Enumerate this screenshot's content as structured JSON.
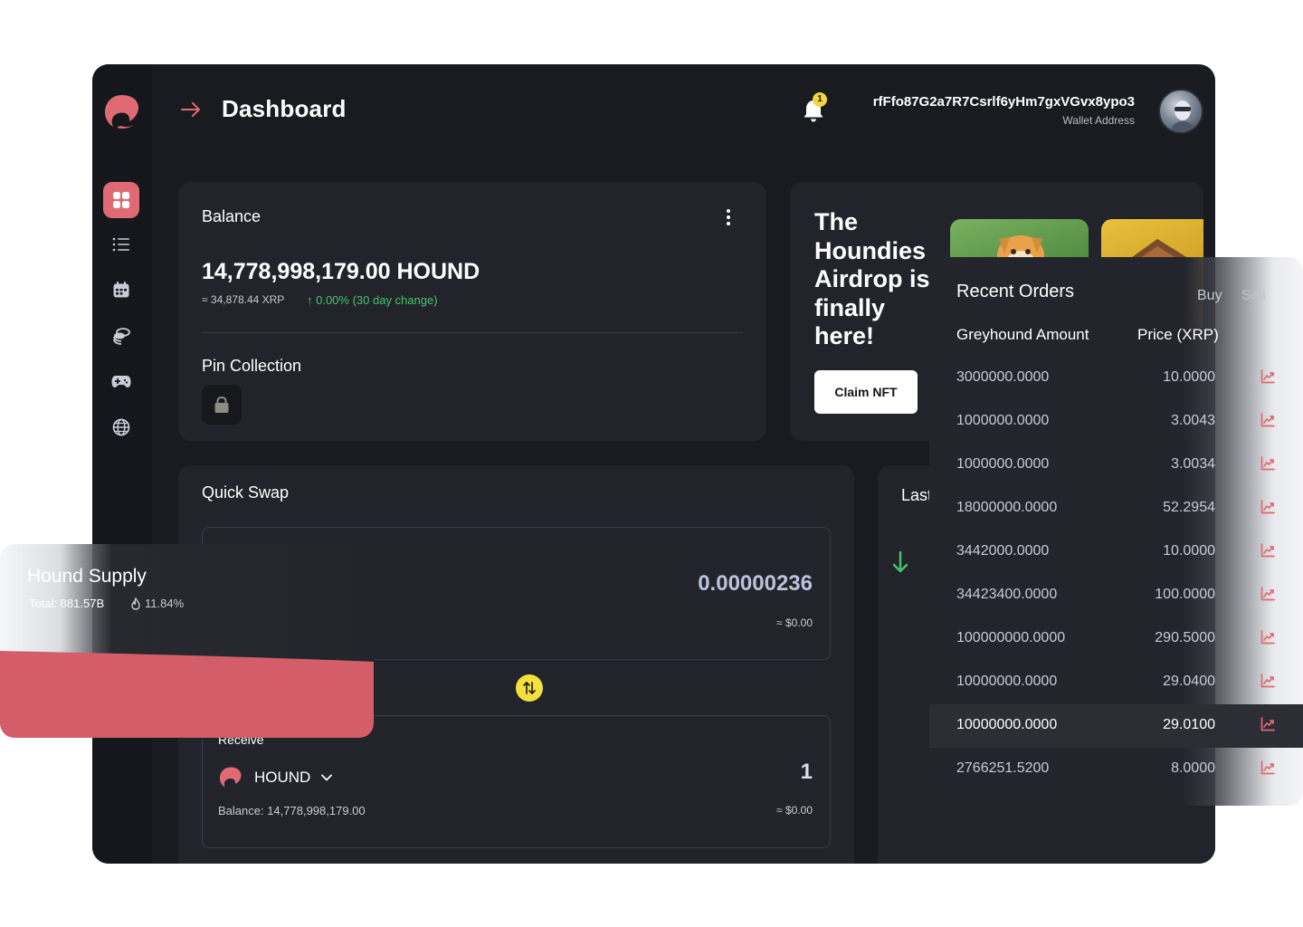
{
  "header": {
    "title": "Dashboard",
    "notification_count": "1",
    "wallet_address": "rfFfo87G2a7R7Csrlf6yHm7gxVGvx8ypo3",
    "wallet_label": "Wallet Address"
  },
  "sidebar": {
    "items": [
      {
        "icon": "grid-icon",
        "active": true
      },
      {
        "icon": "list-icon",
        "active": false
      },
      {
        "icon": "calendar-icon",
        "active": false
      },
      {
        "icon": "coins-icon",
        "active": false
      },
      {
        "icon": "gamepad-icon",
        "active": false
      },
      {
        "icon": "globe-icon",
        "active": false
      }
    ]
  },
  "balance": {
    "title": "Balance",
    "amount": "14,778,998,179.00 HOUND",
    "xrp": "≈ 34,878.44 XRP",
    "change": "↑ 0.00% (30 day change)",
    "pin_title": "Pin Collection"
  },
  "airdrop": {
    "title": "The Houndies Airdrop is finally here!",
    "button_label": "Claim NFT"
  },
  "swap": {
    "title": "Quick Swap",
    "top_value": "0.00000236",
    "top_usd": "≈ $0.00",
    "receive_label": "Receive",
    "token": "HOUND",
    "receive_value": "1",
    "receive_balance": "Balance: 14,778,998,179.00",
    "receive_usd": "≈ $0.00"
  },
  "last": {
    "title": "Last"
  },
  "supply": {
    "title": "Hound Supply",
    "total": "Total: 881.57B",
    "burn_pct": "11.84%"
  },
  "orders": {
    "title": "Recent Orders",
    "tab_buy": "Buy",
    "tab_sell": "Sell",
    "col_amount": "Greyhound Amount",
    "col_price": "Price (XRP)",
    "rows": [
      {
        "amount": "3000000.0000",
        "price": "10.0000"
      },
      {
        "amount": "1000000.0000",
        "price": "3.0043"
      },
      {
        "amount": "1000000.0000",
        "price": "3.0034"
      },
      {
        "amount": "18000000.0000",
        "price": "52.2954"
      },
      {
        "amount": "3442000.0000",
        "price": "10.0000"
      },
      {
        "amount": "34423400.0000",
        "price": "100.0000"
      },
      {
        "amount": "100000000.0000",
        "price": "290.5000"
      },
      {
        "amount": "10000000.0000",
        "price": "29.0400"
      },
      {
        "amount": "10000000.0000",
        "price": "29.0100"
      },
      {
        "amount": "2766251.5200",
        "price": "8.0000"
      }
    ]
  },
  "colors": {
    "accent": "#e06a73",
    "background": "#1a1b20",
    "card": "#23242b",
    "positive": "#45c66a",
    "toggle": "#f4df3d"
  }
}
